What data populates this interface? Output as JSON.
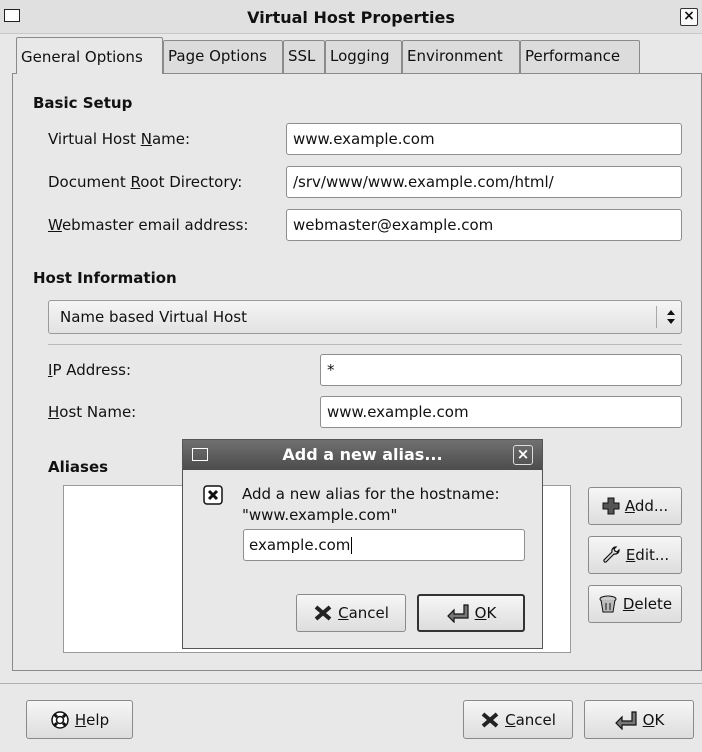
{
  "window": {
    "title": "Virtual Host Properties",
    "close_glyph": "×"
  },
  "tabs": [
    {
      "label": "General Options",
      "active": true
    },
    {
      "label": "Page Options"
    },
    {
      "label": "SSL"
    },
    {
      "label": "Logging"
    },
    {
      "label": "Environment"
    },
    {
      "label": "Performance"
    }
  ],
  "basic_setup": {
    "heading": "Basic Setup",
    "vhost_name": {
      "pre": "Virtual Host ",
      "mn": "N",
      "post": "ame:",
      "value": "www.example.com"
    },
    "docroot": {
      "pre": "Document ",
      "mn": "R",
      "post": "oot Directory:",
      "value": "/srv/www/www.example.com/html/"
    },
    "webmaster": {
      "pre": "",
      "mn": "W",
      "post": "ebmaster email address:",
      "value": "webmaster@example.com"
    }
  },
  "host_info": {
    "heading": "Host Information",
    "type_selected": "Name based Virtual Host",
    "ip": {
      "mn": "I",
      "post": "P Address:",
      "value": "*"
    },
    "hostname": {
      "mn": "H",
      "post": "ost Name:",
      "value": "www.example.com"
    }
  },
  "aliases": {
    "heading": "Aliases",
    "add": {
      "mn": "A",
      "post": "dd..."
    },
    "edit": {
      "mn": "E",
      "post": "dit..."
    },
    "delete": {
      "mn": "D",
      "post": "elete"
    }
  },
  "footer": {
    "help": {
      "mn": "H",
      "post": "elp"
    },
    "cancel": {
      "mn": "C",
      "post": "ancel"
    },
    "ok": {
      "mn": "O",
      "post": "K"
    }
  },
  "dialog": {
    "title": "Add a new alias...",
    "close_glyph": "×",
    "message_line1": "Add a new alias for the hostname:",
    "message_line2": "\"www.example.com\"",
    "value": "example.com",
    "cancel": {
      "mn": "C",
      "post": "ancel"
    },
    "ok": {
      "mn": "O",
      "post": "K"
    }
  },
  "icons": {
    "add": "plus-icon",
    "edit": "wrench-icon",
    "delete": "trash-icon",
    "help": "lifebuoy-icon",
    "cancel": "x-mark-icon",
    "ok": "enter-arrow-icon",
    "dialog": "question-icon"
  }
}
